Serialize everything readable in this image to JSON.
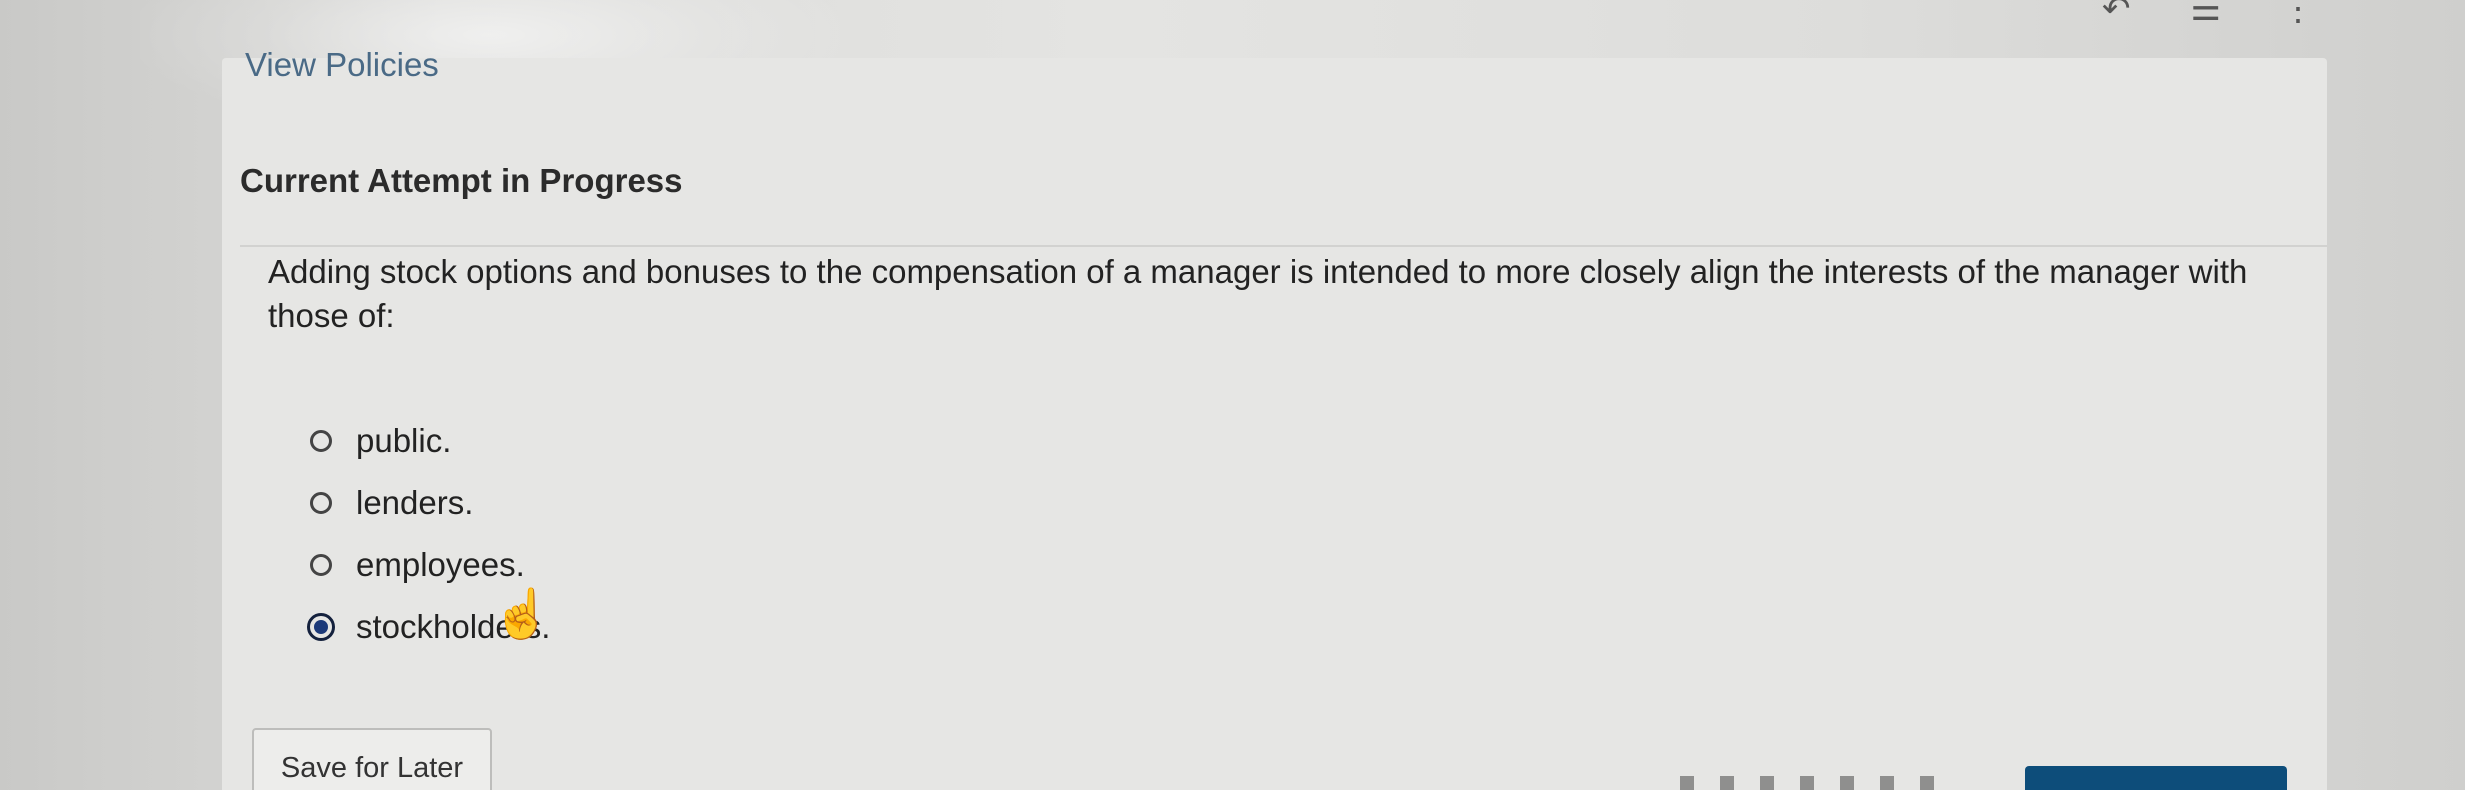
{
  "header": {
    "view_policies": "View Policies"
  },
  "attempt": {
    "title": "Current Attempt in Progress"
  },
  "question": {
    "text": "Adding stock options and bonuses to the compensation of a manager is intended to more closely align the interests of the manager with those of:",
    "options": [
      {
        "label": "public.",
        "selected": false
      },
      {
        "label": "lenders.",
        "selected": false
      },
      {
        "label": "employees.",
        "selected": false
      },
      {
        "label": "stockholders.",
        "selected": true
      }
    ]
  },
  "footer": {
    "save_label": "Save for Later"
  },
  "icons": {
    "undo": "undo-icon",
    "list": "list-icon",
    "more": "more-vertical-icon",
    "cursor": "hand-pointer-icon"
  },
  "colors": {
    "link": "#4a6a86",
    "selected_radio": "#1c3a7a",
    "submit": "#0d4d7a"
  }
}
